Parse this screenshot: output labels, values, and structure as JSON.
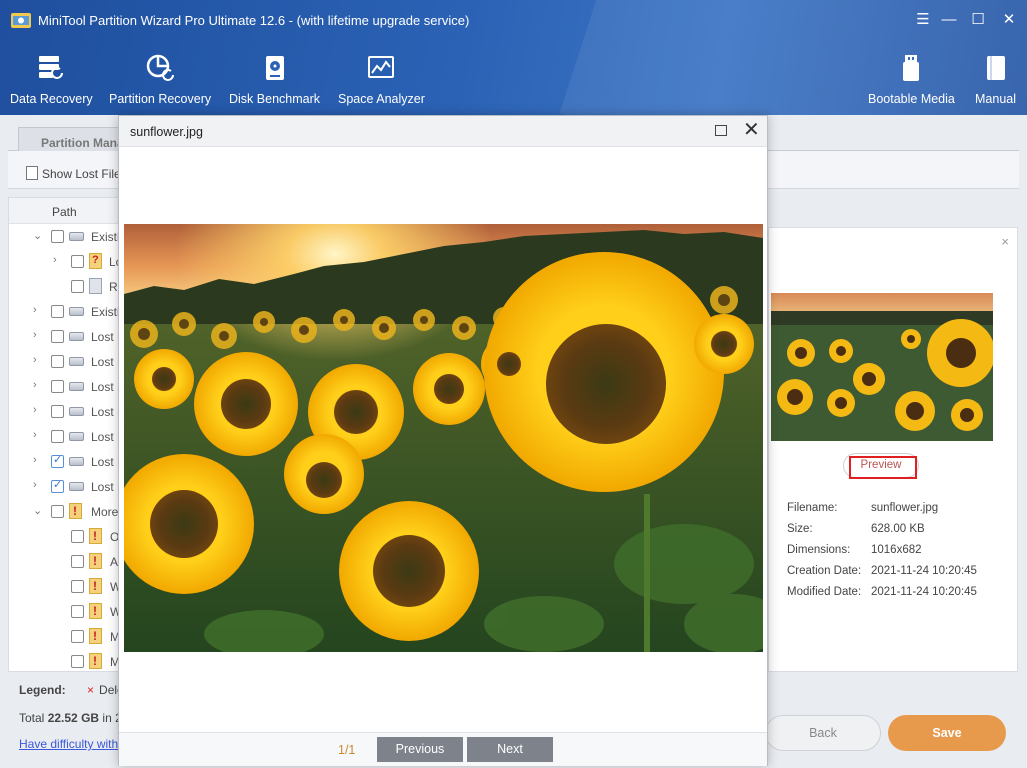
{
  "app": {
    "title": "MiniTool Partition Wizard Pro Ultimate 12.6 - (with lifetime upgrade service)",
    "window_controls": [
      "☰",
      "—",
      "☐",
      "✕"
    ]
  },
  "toolbar": {
    "data_recovery": "Data Recovery",
    "partition_recovery": "Partition Recovery",
    "disk_benchmark": "Disk Benchmark",
    "space_analyzer": "Space Analyzer",
    "bootable_media": "Bootable Media",
    "manual": "Manual"
  },
  "tabs": {
    "partition_management": "Partition Mana"
  },
  "subbar": {
    "show_lost_files": "Show Lost File"
  },
  "tree": {
    "header_path": "Path",
    "rows": [
      {
        "label": "Existi",
        "checked": false
      },
      {
        "label": "Lc",
        "checked": false
      },
      {
        "label": "Ri",
        "checked": false
      },
      {
        "label": "Existi",
        "checked": false
      },
      {
        "label": "Lost P",
        "checked": false
      },
      {
        "label": "Lost P",
        "checked": false
      },
      {
        "label": "Lost P",
        "checked": false
      },
      {
        "label": "Lost P",
        "checked": false
      },
      {
        "label": "Lost P",
        "checked": false
      },
      {
        "label": "Lost P",
        "checked": true
      },
      {
        "label": "Lost P",
        "checked": true
      },
      {
        "label": "More",
        "checked": false
      },
      {
        "label": "O",
        "checked": false
      },
      {
        "label": "A",
        "checked": false
      },
      {
        "label": "W",
        "checked": false
      },
      {
        "label": "W",
        "checked": false
      },
      {
        "label": "M",
        "checked": false
      },
      {
        "label": "M",
        "checked": false
      }
    ]
  },
  "details": {
    "close": "×",
    "preview_button": "Preview",
    "filename_label": "Filename:",
    "filename_value": "sunflower.jpg",
    "size_label": "Size:",
    "size_value": "628.00 KB",
    "dimensions_label": "Dimensions:",
    "dimensions_value": "1016x682",
    "creation_label": "Creation Date:",
    "creation_value": "2021-11-24 10:20:45",
    "modified_label": "Modified Date:",
    "modified_value": "2021-11-24 10:20:45"
  },
  "footer": {
    "legend_label": "Legend:",
    "legend_deleted_icon": "×",
    "legend_deleted": "Dele",
    "total_prefix": "Total",
    "total_value": "22.52 GB",
    "total_suffix": "in 2",
    "help_link": "Have difficulty with",
    "back": "Back",
    "save": "Save"
  },
  "dialog": {
    "title": "sunflower.jpg",
    "page_indicator": "1/1",
    "previous": "Previous",
    "next": "Next",
    "close": "✕"
  },
  "colors": {
    "header_blue": "#2b62b5",
    "save_orange": "#e89a4c",
    "nav_gray": "#7e838b",
    "highlight_red": "#e02020"
  }
}
